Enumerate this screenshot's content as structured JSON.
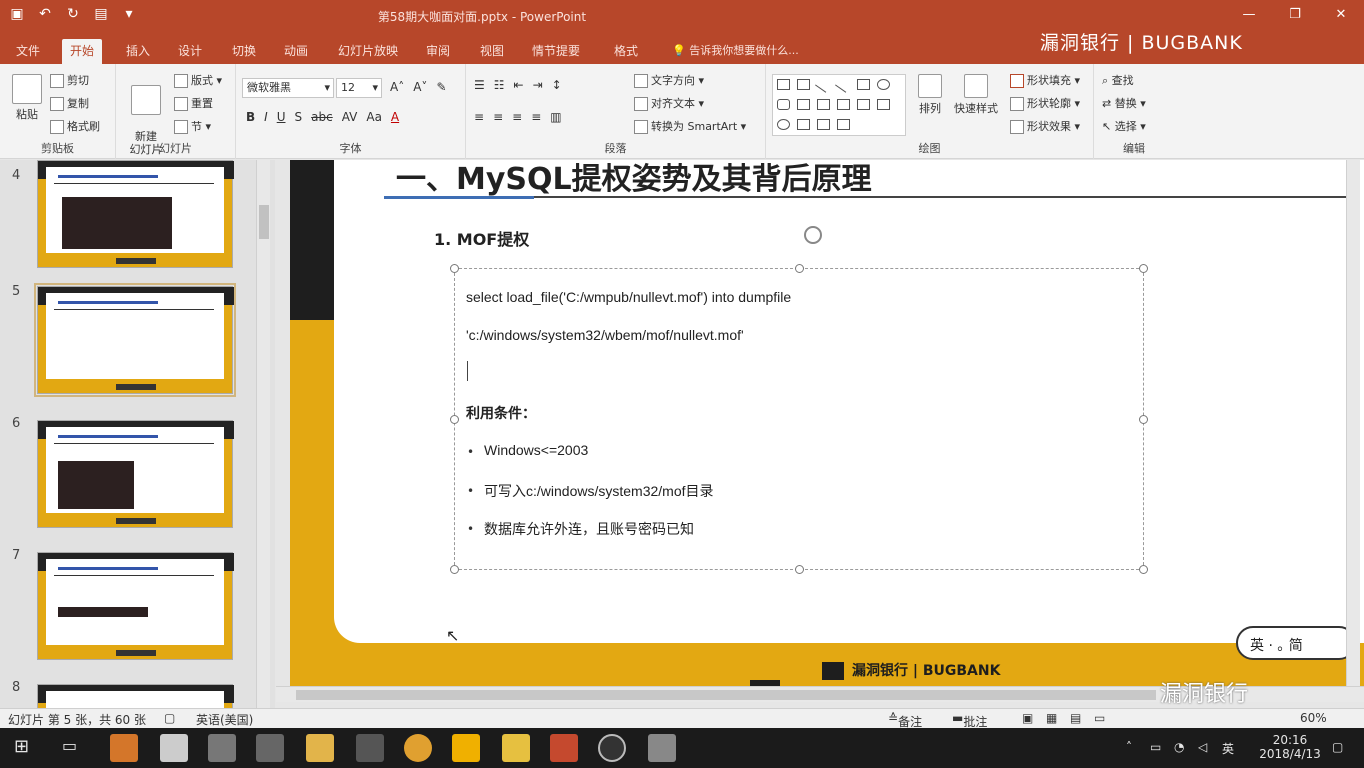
{
  "window": {
    "title": "第58期大咖面对面.pptx - PowerPoint",
    "brand": "漏洞银行 | BUGBANK",
    "controls": [
      "—",
      "❐",
      "✕"
    ]
  },
  "qat": [
    "save-icon",
    "undo-icon",
    "redo-icon",
    "present-icon",
    "customize-icon"
  ],
  "ribbon_tabs": [
    "文件",
    "开始",
    "插入",
    "设计",
    "切换",
    "动画",
    "幻灯片放映",
    "审阅",
    "视图",
    "情节提要",
    "格式"
  ],
  "active_tab": "开始",
  "tell_me": "告诉我你想要做什么...",
  "ribbon": {
    "clipboard": {
      "paste": "粘贴",
      "cut": "剪切",
      "copy": "复制",
      "format_painter": "格式刷",
      "label": "剪贴板"
    },
    "slides": {
      "new_slide": "新建\n幻灯片",
      "layout": "版式",
      "reset": "重置",
      "section": "节",
      "label": "幻灯片"
    },
    "font": {
      "name": "微软雅黑",
      "size": "12",
      "label": "字体"
    },
    "paragraph": {
      "text_direction": "文字方向",
      "align_text": "对齐文本",
      "smartart": "转换为 SmartArt",
      "label": "段落"
    },
    "drawing": {
      "arrange": "排列",
      "quick_styles": "快速样式",
      "shape_fill": "形状填充",
      "shape_outline": "形状轮廓",
      "shape_effects": "形状效果",
      "label": "绘图"
    },
    "editing": {
      "find": "查找",
      "replace": "替换",
      "select": "选择",
      "label": "编辑"
    }
  },
  "thumbnails": [
    {
      "num": "4",
      "selected": false
    },
    {
      "num": "5",
      "selected": true
    },
    {
      "num": "6",
      "selected": false
    },
    {
      "num": "7",
      "selected": false
    },
    {
      "num": "8",
      "selected": false
    }
  ],
  "slide": {
    "heading": "一、MySQL提权姿势及其背后原理",
    "sub_heading": "1. MOF提权",
    "code_line1": "select load_file('C:/wmpub/nullevt.mof') into dumpfile",
    "code_line2": "'c:/windows/system32/wbem/mof/nullevt.mof'",
    "conditions_title": "利用条件：",
    "bullets": [
      "Windows<=2003",
      "可写入c:/windows/system32/mof目录",
      "数据库允许外连，且账号密码已知"
    ],
    "footer_brand": "漏洞银行 | BUGBANK"
  },
  "ime": "英 · ｡ 简",
  "statusbar": {
    "slide_info": "幻灯片 第 5 张，共 60 张",
    "language": "英语(美国)",
    "notes": "备注",
    "comments": "批注",
    "zoom": "60%"
  },
  "watermark": "漏洞银行",
  "clock": {
    "time": "20:16",
    "date": "2018/4/13",
    "ime": "英"
  },
  "colors": {
    "accent": "#b7472a",
    "slide_yellow": "#e3a812",
    "slide_dark": "#1e1e1e"
  }
}
